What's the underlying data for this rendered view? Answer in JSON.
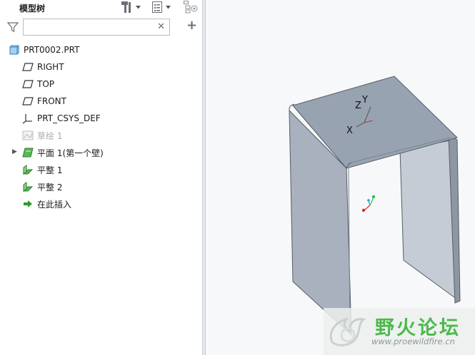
{
  "model_tree": {
    "title": "模型树",
    "tool_icons": [
      "settings-hammer-icon",
      "list-view-icon",
      "tree-filter-icon"
    ],
    "search": {
      "value": "",
      "placeholder": ""
    },
    "items": [
      {
        "label": "PRT0002.PRT",
        "icon": "part-icon",
        "state": "normal"
      },
      {
        "label": "RIGHT",
        "icon": "datum-plane-icon",
        "state": "normal"
      },
      {
        "label": "TOP",
        "icon": "datum-plane-icon",
        "state": "normal"
      },
      {
        "label": "FRONT",
        "icon": "datum-plane-icon",
        "state": "normal"
      },
      {
        "label": "PRT_CSYS_DEF",
        "icon": "csys-icon",
        "state": "normal"
      },
      {
        "label": "草绘 1",
        "icon": "sketch-icon",
        "state": "suppressed"
      },
      {
        "label": "平面 1(第一个壁)",
        "icon": "flat-wall-icon",
        "state": "collapsed"
      },
      {
        "label": "平整 1",
        "icon": "flat-feature-icon",
        "state": "normal"
      },
      {
        "label": "平整 2",
        "icon": "flat-feature-icon",
        "state": "normal"
      },
      {
        "label": "在此插入",
        "icon": "insert-here-arrow-icon",
        "state": "normal"
      }
    ]
  },
  "viewport": {
    "axis_labels": {
      "z": "Z",
      "y": "Y",
      "x": "X"
    },
    "colors": {
      "surface": "#a7b0bc",
      "top": "#97a2b0",
      "edge": "#555c66",
      "background": "#f7f8f9"
    }
  },
  "watermark": {
    "title": "野火论坛",
    "url": "www.proewildfire.cn"
  },
  "colors": {
    "accent": "#4db94b",
    "tree_icon_green": "#3d9a3a",
    "disabled": "#a9adb2"
  }
}
